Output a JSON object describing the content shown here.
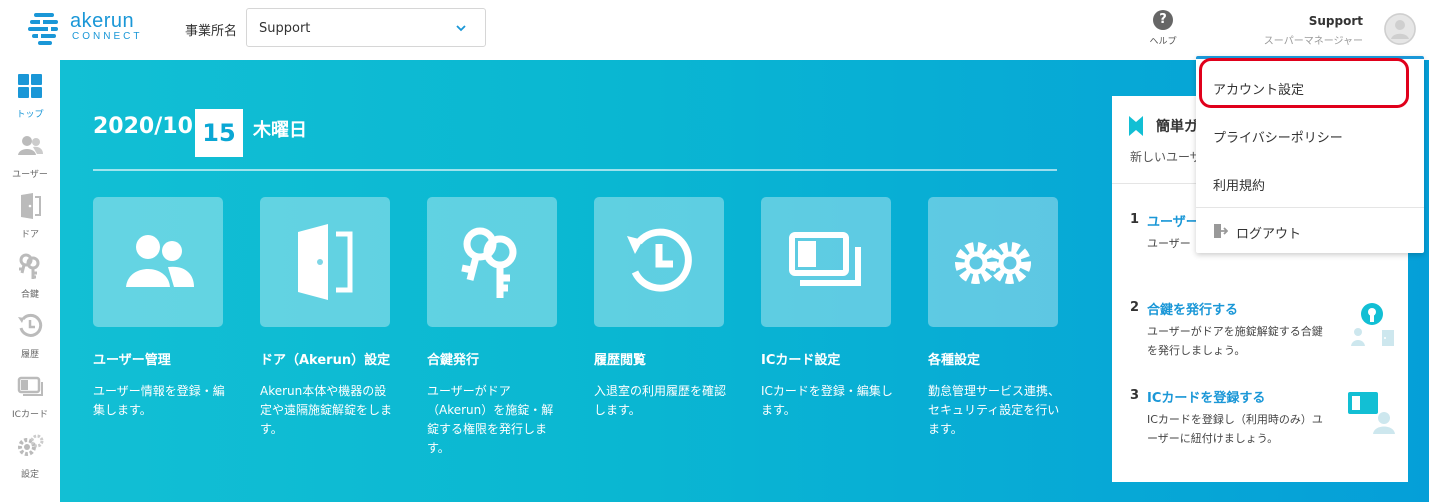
{
  "brand": {
    "name": "akerun",
    "sub": "CONNECT",
    "color": "#1a97d7"
  },
  "header": {
    "office_label": "事業所名",
    "office_value": "Support",
    "help_label": "ヘルプ",
    "user_name": "Support",
    "user_role": "スーパーマネージャー"
  },
  "sidebar": {
    "items": [
      {
        "label": "トップ",
        "icon": "grid-icon",
        "active": true
      },
      {
        "label": "ユーザー",
        "icon": "users-icon"
      },
      {
        "label": "ドア",
        "icon": "door-icon"
      },
      {
        "label": "合鍵",
        "icon": "key-icon"
      },
      {
        "label": "履歴",
        "icon": "history-icon"
      },
      {
        "label": "ICカード",
        "icon": "card-icon"
      },
      {
        "label": "設定",
        "icon": "gear-icon"
      }
    ]
  },
  "date": {
    "year_month": "2020/10",
    "day": "15",
    "weekday": "木曜日"
  },
  "cards": [
    {
      "title": "ユーザー管理",
      "desc": "ユーザー情報を登録・編集します。",
      "icon": "users-icon"
    },
    {
      "title": "ドア（Akerun）設定",
      "desc": "Akerun本体や機器の設定や遠隔施錠解錠をします。",
      "icon": "door-icon"
    },
    {
      "title": "合鍵発行",
      "desc": "ユーザーがドア（Akerun）を施錠・解錠する権限を発行します。",
      "icon": "key-icon"
    },
    {
      "title": "履歴閲覧",
      "desc": "入退室の利用履歴を確認します。",
      "icon": "history-icon"
    },
    {
      "title": "ICカード設定",
      "desc": "ICカードを登録・編集します。",
      "icon": "card-icon"
    },
    {
      "title": "各種設定",
      "desc": "勤怠管理サービス連携、セキュリティ設定を行います。",
      "icon": "gear-icon"
    }
  ],
  "guide": {
    "title": "簡単ガ",
    "subtitle": "新しいユーザ",
    "steps": [
      {
        "num": "1",
        "title": "ユーザー",
        "desc": "ユーザー"
      },
      {
        "num": "2",
        "title": "合鍵を発行する",
        "desc": "ユーザーがドアを施錠解錠する合鍵を発行しましょう。"
      },
      {
        "num": "3",
        "title": "ICカードを登録する",
        "desc": "ICカードを登録し（利用時のみ）ユーザーに紐付けましょう。"
      }
    ]
  },
  "dropdown": {
    "items": [
      {
        "label": "アカウント設定"
      },
      {
        "label": "プライバシーポリシー"
      },
      {
        "label": "利用規約"
      },
      {
        "label": "ログアウト",
        "icon": "logout-icon"
      }
    ]
  },
  "colors": {
    "accent": "#1a97d7",
    "main_bg_start": "#12bfd4",
    "main_bg_end": "#059fd8",
    "highlight": "#e0001b"
  }
}
